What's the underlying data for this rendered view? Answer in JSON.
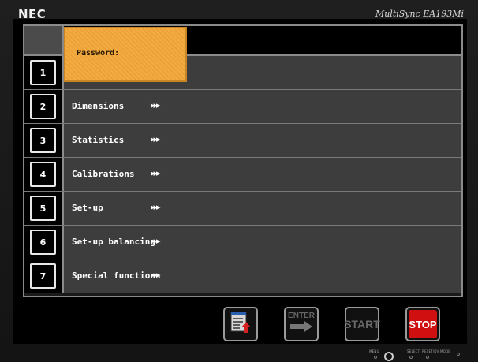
{
  "brand": "NEC",
  "model": "MultiSync EA193Mi",
  "password_popup": {
    "label": "Password:"
  },
  "menu": [
    {
      "number": "1",
      "label": "",
      "arrows": ""
    },
    {
      "number": "2",
      "label": "Dimensions",
      "arrows": "▸▸▸"
    },
    {
      "number": "3",
      "label": "Statistics",
      "arrows": "▸▸▸"
    },
    {
      "number": "4",
      "label": "Calibrations",
      "arrows": "▸▸▸"
    },
    {
      "number": "5",
      "label": "Set-up",
      "arrows": "▸▸▸"
    },
    {
      "number": "6",
      "label": "Set-up balancing",
      "arrows": "▸▸▸"
    },
    {
      "number": "7",
      "label": "Special functions",
      "arrows": "▸▸▸"
    }
  ],
  "buttons": {
    "list_icon": "list-upload-icon",
    "enter_label": "ENTER",
    "start_label": "START",
    "stop_label": "STOP"
  },
  "bezel_controls": {
    "menu_label": "MENU",
    "select_label": "SELECT",
    "reset_label": "RESET/DV MODE"
  },
  "colors": {
    "popup": "#f0a63a",
    "stop": "#d01010",
    "row_bg": "#3d3d3d"
  }
}
